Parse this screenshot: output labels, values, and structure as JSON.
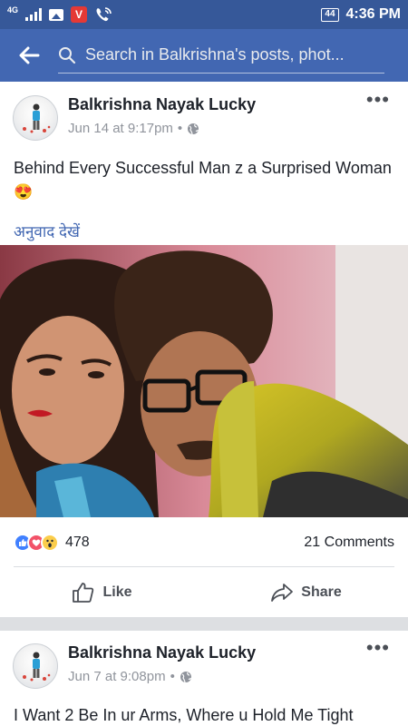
{
  "status_bar": {
    "network": "4G",
    "app_badge": "V",
    "battery": "44",
    "time": "4:36 PM"
  },
  "header": {
    "search_text": "Search in Balkrishna's posts, phot..."
  },
  "posts": [
    {
      "author": "Balkrishna Nayak Lucky",
      "timestamp": "Jun 14 at 9:17pm",
      "separator": "•",
      "text": "Behind Every Successful Man z a Surprised Woman",
      "emoji": "😍",
      "translate": "अनुवाद देखें",
      "reaction_count": "478",
      "comments": "21 Comments",
      "like_label": "Like",
      "share_label": "Share"
    },
    {
      "author": "Balkrishna Nayak Lucky",
      "timestamp": "Jun 7 at 9:08pm",
      "separator": "•",
      "text": "I Want 2 Be In ur Arms, Where u Hold Me Tight"
    }
  ],
  "colors": {
    "status_bar": "#365899",
    "header": "#4267b2",
    "link": "#4267b2"
  },
  "icons": [
    "back-arrow-icon",
    "search-icon",
    "more-icon",
    "globe-icon",
    "like-reaction-icon",
    "love-reaction-icon",
    "wow-reaction-icon",
    "like-icon",
    "share-icon"
  ]
}
